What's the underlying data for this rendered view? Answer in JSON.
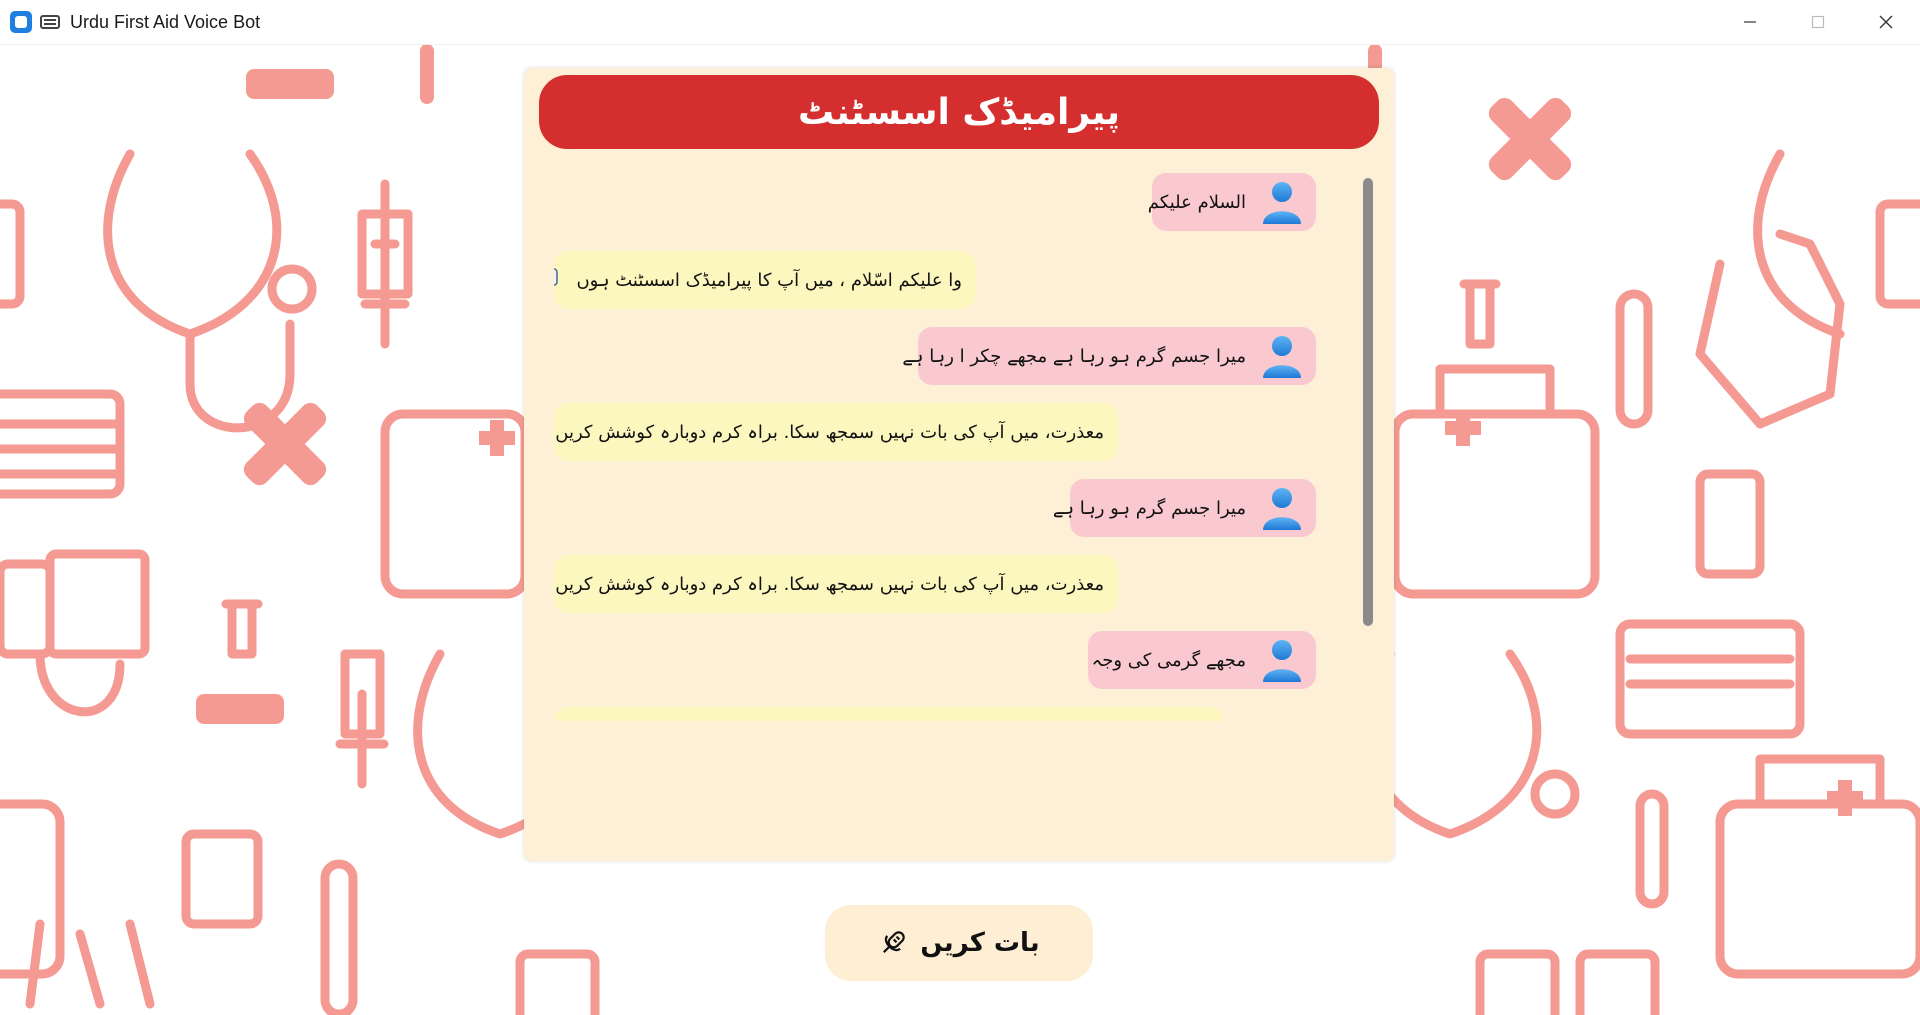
{
  "window": {
    "title": "Urdu First Aid Voice Bot"
  },
  "header": {
    "title": "پیرامیڈک اسسٹنٹ"
  },
  "messages": [
    {
      "role": "user",
      "text": "السلام علیکم"
    },
    {
      "role": "bot",
      "text": "وا علیکم اسّلام ، میں آپ کا پیرامیڈک اسسٹنٹ ہوں"
    },
    {
      "role": "user",
      "text": "میرا جسم گرم ہو رہا ہے مجھے چکر ا رہا ہے"
    },
    {
      "role": "bot",
      "text": "معذرت، میں آپ کی بات نہیں سمجھ سکا. براہ کرم دوبارہ کوشش کریں."
    },
    {
      "role": "user",
      "text": "میرا جسم گرم ہو رہا ہے"
    },
    {
      "role": "bot",
      "text": "معذرت، میں آپ کی بات نہیں سمجھ سکا. براہ کرم دوبارہ کوشش کریں."
    },
    {
      "role": "user",
      "text": "مجھے گرمی کی وجہ"
    }
  ],
  "talk_button": {
    "label": "بات کریں",
    "icon": "microphone-icon"
  },
  "colors": {
    "header_bg": "#d42e2e",
    "panel_bg": "#fdf0d7",
    "user_bubble": "#f9c9cf",
    "bot_bubble": "#fcf6bf",
    "pattern": "#f49a92"
  }
}
